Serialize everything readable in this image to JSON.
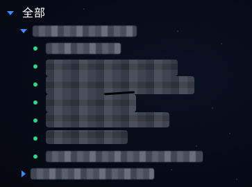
{
  "colors": {
    "background": "#060a16",
    "caret": "#3d8bfd",
    "status_dot": "#2bd98a",
    "root_text": "#ffffff"
  },
  "tree": {
    "root": {
      "label": "全部",
      "icon": "caret-down-icon",
      "expanded": true
    },
    "group": {
      "icon": "caret-down-icon",
      "expanded": true
    },
    "children_status_icon": "status-dot-icon",
    "collapsed_group": {
      "icon": "caret-right-icon",
      "expanded": false
    }
  }
}
